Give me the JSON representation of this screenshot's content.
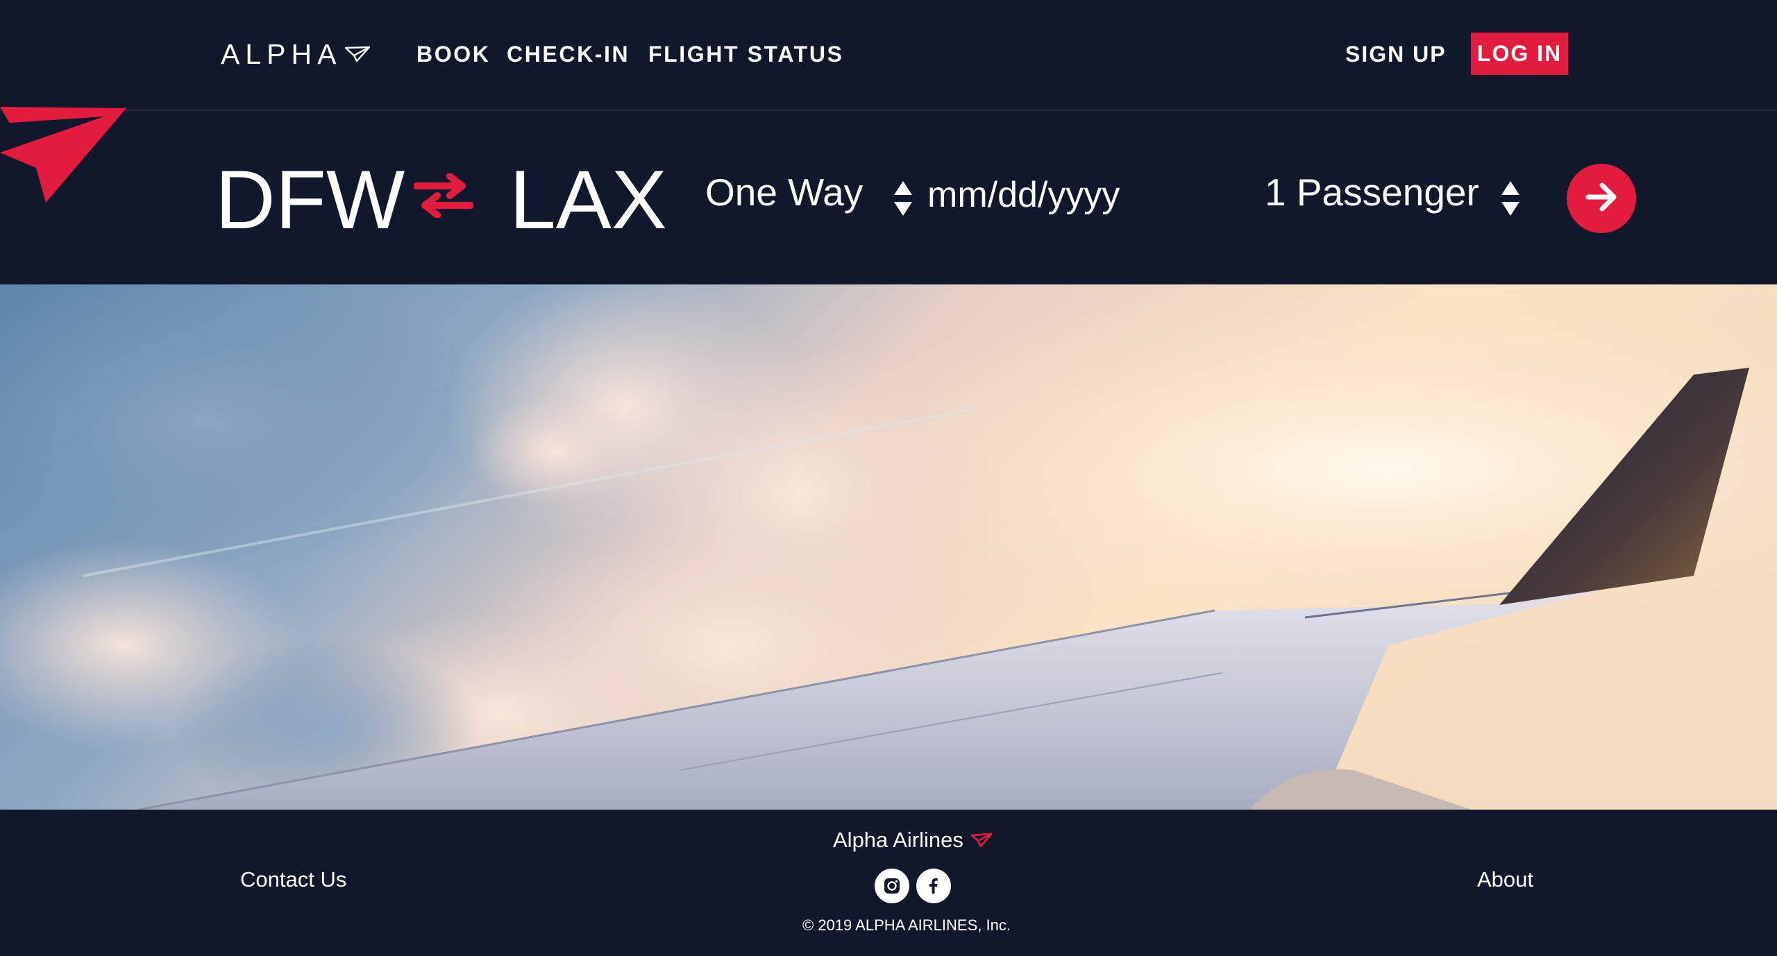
{
  "brand": {
    "name": "ALPHA",
    "logo_icon": "paper-plane-icon"
  },
  "nav": {
    "book": "BOOK",
    "checkin": "CHECK-IN",
    "flight_status": "FLIGHT STATUS",
    "signup": "SIGN UP",
    "login": "LOG IN"
  },
  "search": {
    "origin": "DFW",
    "destination": "LAX",
    "swap_icon": "swap-arrows-icon",
    "trip_type": "One Way",
    "date_placeholder": "mm/dd/yyyy",
    "passengers": "1 Passenger",
    "submit_icon": "arrow-right-icon"
  },
  "hero": {
    "image": "airplane-wing-above-clouds"
  },
  "footer": {
    "brand": "Alpha Airlines",
    "contact": "Contact Us",
    "about": "About",
    "copyright": "© 2019 ALPHA AIRLINES, Inc.",
    "social": [
      "instagram-icon",
      "facebook-icon"
    ]
  },
  "colors": {
    "background": "#12182b",
    "accent": "#e31c3d",
    "text": "#ffffff"
  }
}
